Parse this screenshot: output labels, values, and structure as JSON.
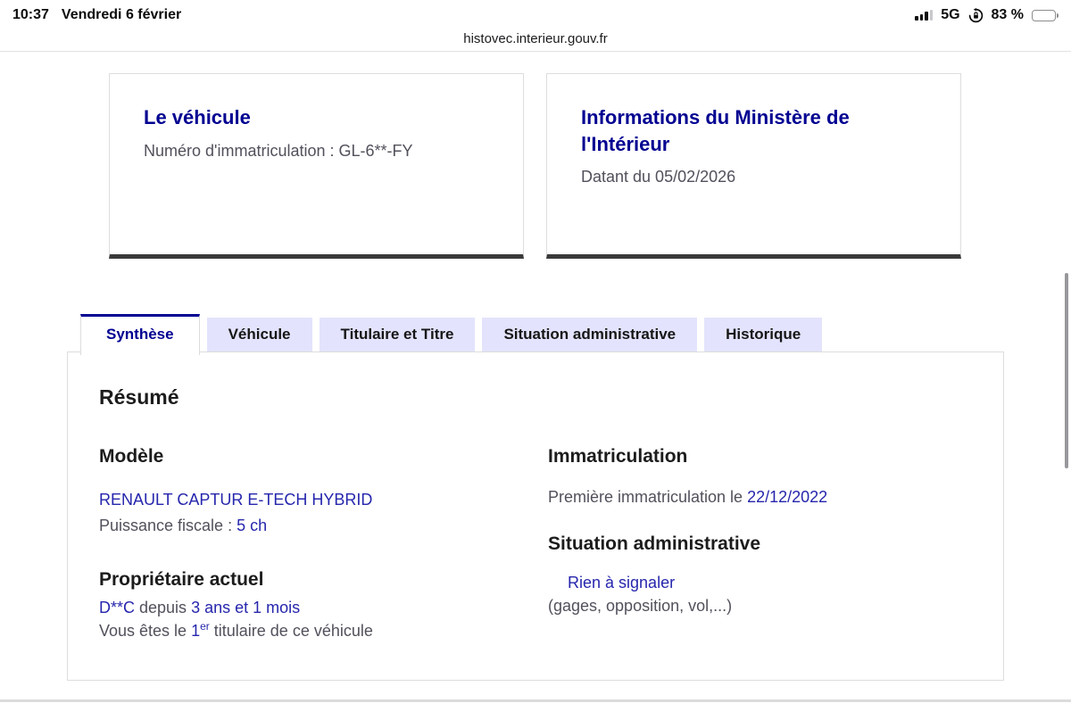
{
  "status_bar": {
    "time": "10:37",
    "date": "Vendredi 6 février",
    "network": "5G",
    "battery_percent": "83 %"
  },
  "url_bar": {
    "url": "histovec.interieur.gouv.fr"
  },
  "cards": {
    "vehicle": {
      "title": "Le véhicule",
      "line": "Numéro d'immatriculation : GL-6**-FY"
    },
    "ministry": {
      "title": "Informations du Ministère de l'Intérieur",
      "line": "Datant du 05/02/2026"
    }
  },
  "tabs": [
    {
      "label": "Synthèse",
      "active": true
    },
    {
      "label": "Véhicule",
      "active": false
    },
    {
      "label": "Titulaire et Titre",
      "active": false
    },
    {
      "label": "Situation administrative",
      "active": false
    },
    {
      "label": "Historique",
      "active": false
    }
  ],
  "content": {
    "summary_title": "Résumé",
    "model": {
      "heading": "Modèle",
      "name": "RENAULT CAPTUR E-TECH HYBRID",
      "power_label": "Puissance fiscale : ",
      "power_value": "5 ch"
    },
    "owner": {
      "heading": "Propriétaire actuel",
      "name": "D**C",
      "since_label": " depuis ",
      "duration": "3 ans et 1 mois",
      "holder_prefix": "Vous êtes le ",
      "holder_rank": "1",
      "holder_rank_sup": "er",
      "holder_suffix": " titulaire de ce véhicule"
    },
    "registration": {
      "heading": "Immatriculation",
      "label": "Première immatriculation le ",
      "date": "22/12/2022"
    },
    "admin": {
      "heading": "Situation administrative",
      "status": "Rien à signaler",
      "note": "(gages, opposition, vol,...)"
    }
  },
  "colors": {
    "brand_blue": "#000091",
    "value_blue": "#2626ad",
    "tab_inactive_bg": "#e3e3fd",
    "text_gray": "#51515c",
    "card_bottom_border": "#3a3a3a"
  }
}
